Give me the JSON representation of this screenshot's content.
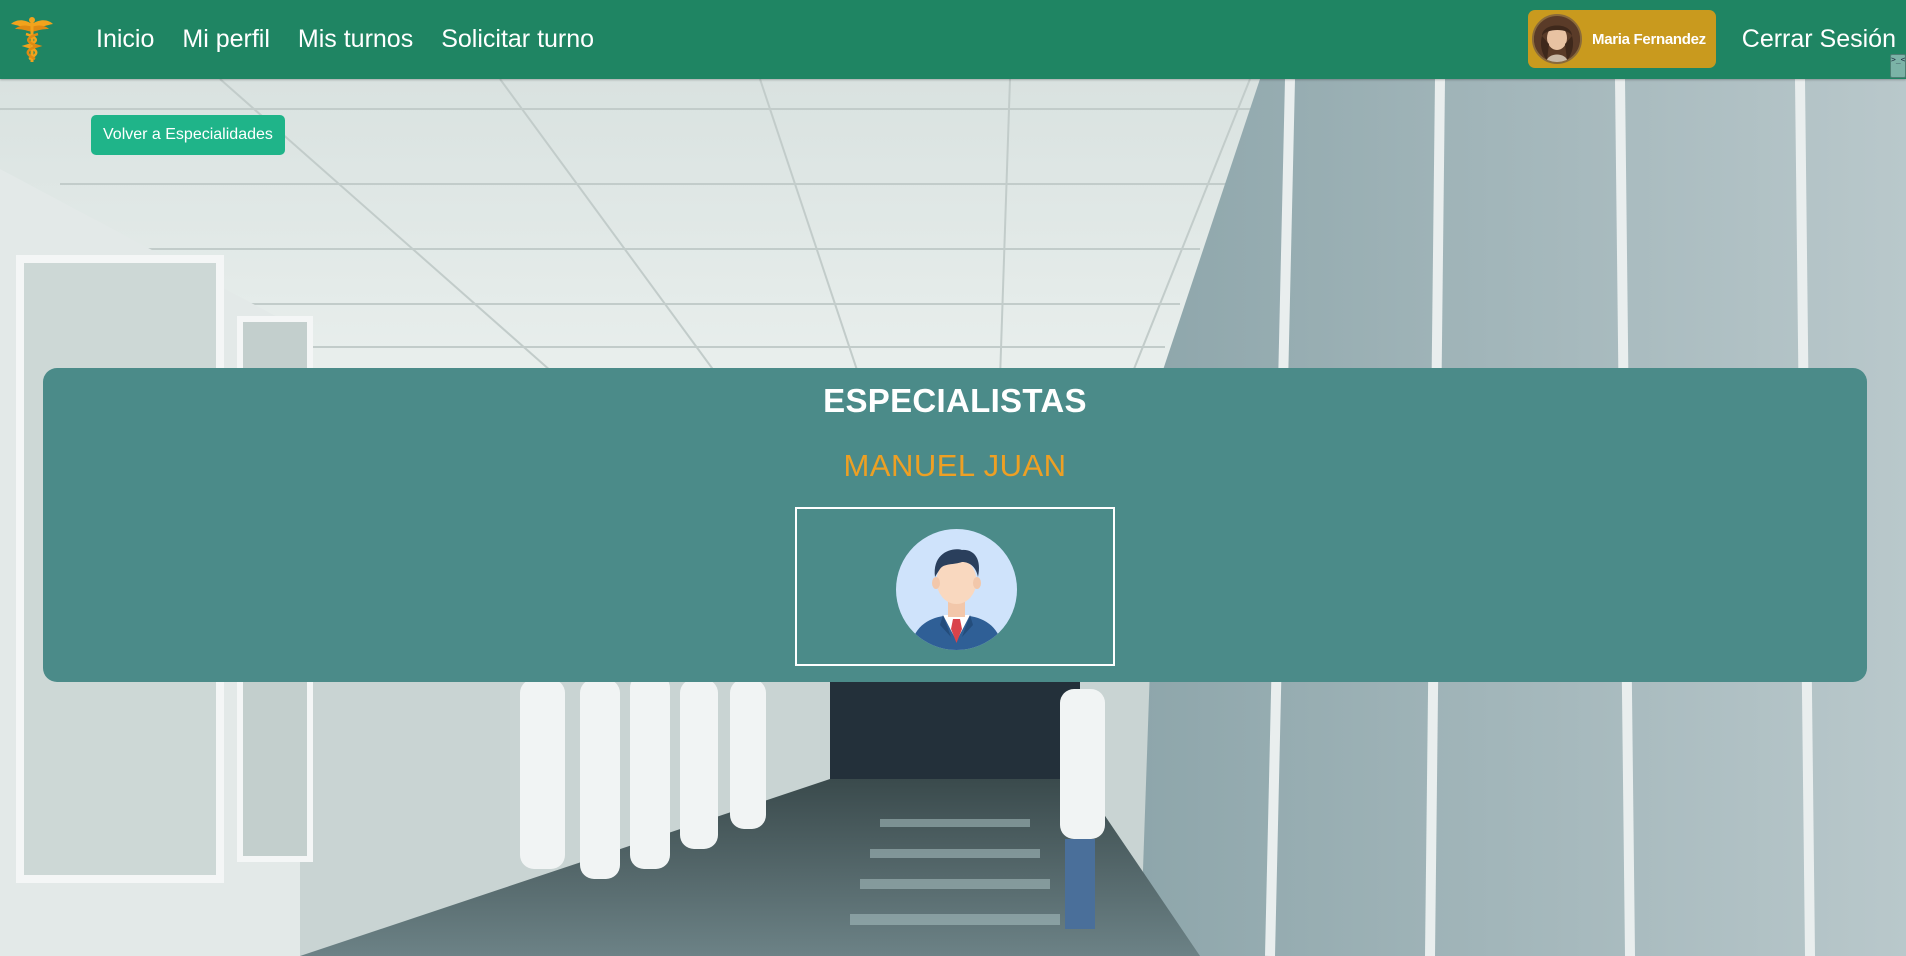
{
  "navbar": {
    "logo_icon": "caduceus-icon",
    "links": [
      "Inicio",
      "Mi perfil",
      "Mis turnos",
      "Solicitar turno"
    ],
    "user_name": "Maria Fernandez",
    "logout_label": "Cerrar Sesión",
    "corner_tag": ">_<",
    "colors": {
      "navbar": "#1f8563",
      "user_chip": "#c99a1e"
    }
  },
  "back_button": {
    "label": "Volver a Especialidades",
    "color": "#1fb489"
  },
  "panel": {
    "title": "ESPECIALISTAS",
    "specialists": [
      {
        "name": "MANUEL JUAN",
        "avatar_icon": "male-doctor-avatar-icon"
      }
    ],
    "colors": {
      "background": "#4b8b89",
      "name": "#eda024"
    }
  }
}
